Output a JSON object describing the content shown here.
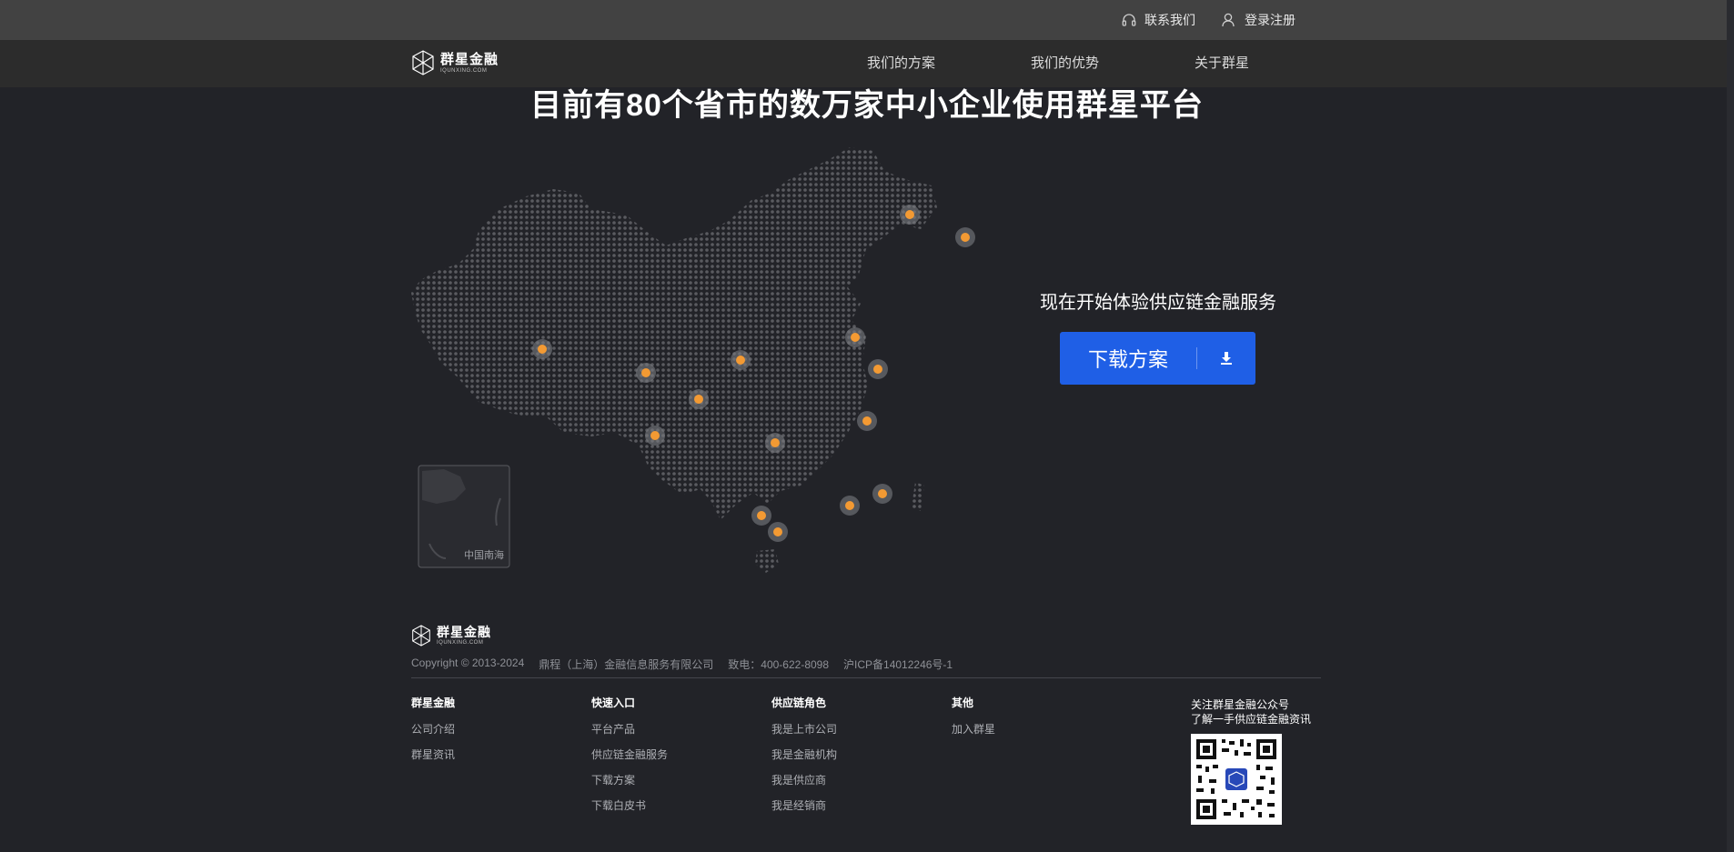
{
  "topbar": {
    "contact_label": "联系我们",
    "login_label": "登录注册",
    "contact_icon": "headset-icon",
    "login_icon": "user-icon"
  },
  "brand": {
    "name": "群星金融",
    "sub": "IQUNXING.COM"
  },
  "nav": {
    "items": [
      "我们的方案",
      "我们的优势",
      "关于群星"
    ]
  },
  "hero": {
    "headline": "目前有80个省市的数万家中小企业使用群星平台",
    "map_inset_label": "中国南海",
    "marker_color": "#f39a33"
  },
  "cta": {
    "title": "现在开始体验供应链金融服务",
    "button_label": "下载方案",
    "button_icon": "download-icon",
    "button_color": "#1f5fe6"
  },
  "footer": {
    "copyright": "Copyright © 2013-2024",
    "company": "鼎程（上海）金融信息服务有限公司",
    "phone": "致电：400-622-8098",
    "icp": "沪ICP备14012246号-1",
    "columns": [
      {
        "title": "群星金融",
        "links": [
          "公司介绍",
          "群星资讯"
        ]
      },
      {
        "title": "快速入口",
        "links": [
          "平台产品",
          "供应链金融服务",
          "下载方案",
          "下载白皮书"
        ]
      },
      {
        "title": "供应链角色",
        "links": [
          "我是上市公司",
          "我是金融机构",
          "我是供应商",
          "我是经销商"
        ]
      },
      {
        "title": "其他",
        "links": [
          "加入群星"
        ]
      }
    ],
    "qr_line1": "关注群星金融公众号",
    "qr_line2": "了解一手供应链金融资讯"
  }
}
